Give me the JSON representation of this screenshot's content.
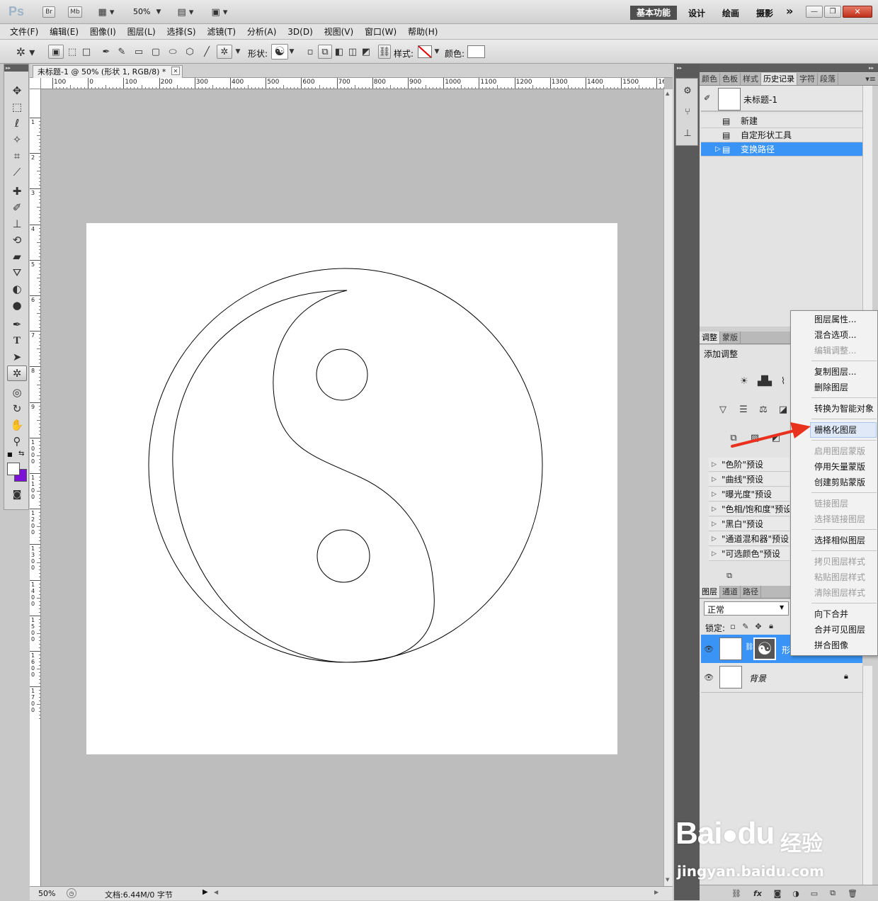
{
  "app": {
    "logo": "Ps",
    "bridge_label": "Br",
    "minibridge_label": "Mb",
    "zoom": "50%",
    "workspaces": [
      "基本功能",
      "设计",
      "绘画",
      "摄影"
    ],
    "more_label": "»"
  },
  "menu": [
    "文件(F)",
    "编辑(E)",
    "图像(I)",
    "图层(L)",
    "选择(S)",
    "滤镜(T)",
    "分析(A)",
    "3D(D)",
    "视图(V)",
    "窗口(W)",
    "帮助(H)"
  ],
  "options": {
    "shape_label": "形状:",
    "style_label": "样式:",
    "color_label": "颜色:",
    "color_value": "#ffffff"
  },
  "document": {
    "tab_title": "未标题-1 @ 50% (形状 1, RGB/8) *",
    "ruler_h_labels": [
      "100",
      "0",
      "100",
      "200",
      "300",
      "400",
      "500",
      "600",
      "700",
      "800",
      "900",
      "1000",
      "1100",
      "1200",
      "1300",
      "1400",
      "1500",
      "16"
    ],
    "ruler_v_labels": [
      "1",
      "2",
      "3",
      "4",
      "5",
      "6",
      "7",
      "8",
      "9",
      "1 0 0 0",
      "1 1 0 0",
      "1 2 0 0",
      "1 3 0 0",
      "1 4 0 0",
      "1 5 0 0",
      "1 6 0 0",
      "1 7 0 0"
    ],
    "status_zoom": "50%",
    "status_doc": "文档:6.44M/0 字节"
  },
  "panels": {
    "top_tabs": [
      "颜色",
      "色板",
      "样式",
      "历史记录",
      "字符",
      "段落"
    ],
    "history_snapshot": "未标题-1",
    "history_items": [
      "新建",
      "自定形状工具",
      "变换路径"
    ],
    "adjust_tabs": [
      "调整",
      "蒙版"
    ],
    "adjust_title": "添加调整",
    "presets": [
      "\"色阶\"预设",
      "\"曲线\"预设",
      "\"曝光度\"预设",
      "\"色相/饱和度\"预设",
      "\"黑白\"预设",
      "\"通道混和器\"预设",
      "\"可选颜色\"预设"
    ],
    "layer_tabs": [
      "图层",
      "通道",
      "路径"
    ],
    "blend_mode": "正常",
    "lock_label": "锁定:",
    "layers": [
      {
        "name": "形",
        "selected": true
      },
      {
        "name": "背景",
        "selected": false
      }
    ]
  },
  "context_menu": {
    "items": [
      {
        "label": "图层属性...",
        "disabled": false
      },
      {
        "label": "混合选项...",
        "disabled": false
      },
      {
        "label": "编辑调整...",
        "disabled": true
      },
      {
        "label": "复制图层...",
        "disabled": false
      },
      {
        "label": "删除图层",
        "disabled": false
      },
      {
        "label": "转换为智能对象",
        "disabled": false
      },
      {
        "label": "栅格化图层",
        "disabled": false
      },
      {
        "label": "启用图层蒙版",
        "disabled": true
      },
      {
        "label": "停用矢量蒙版",
        "disabled": false
      },
      {
        "label": "创建剪贴蒙版",
        "disabled": false
      },
      {
        "label": "链接图层",
        "disabled": true
      },
      {
        "label": "选择链接图层",
        "disabled": true
      },
      {
        "label": "选择相似图层",
        "disabled": false
      },
      {
        "label": "拷贝图层样式",
        "disabled": true
      },
      {
        "label": "粘贴图层样式",
        "disabled": true
      },
      {
        "label": "清除图层样式",
        "disabled": true
      },
      {
        "label": "向下合并",
        "disabled": false
      },
      {
        "label": "合并可见图层",
        "disabled": false
      },
      {
        "label": "拼合图像",
        "disabled": false
      }
    ],
    "highlighted": "栅格化图层"
  },
  "watermark": {
    "brand": "Bai",
    "brand2": "du",
    "brand_cn": "经验",
    "url": "jingyan.baidu.com"
  },
  "colors": {
    "selection": "#3a94f5",
    "arrow": "#e8321e",
    "foreground": "#ffffff",
    "background": "#7c10d6"
  }
}
